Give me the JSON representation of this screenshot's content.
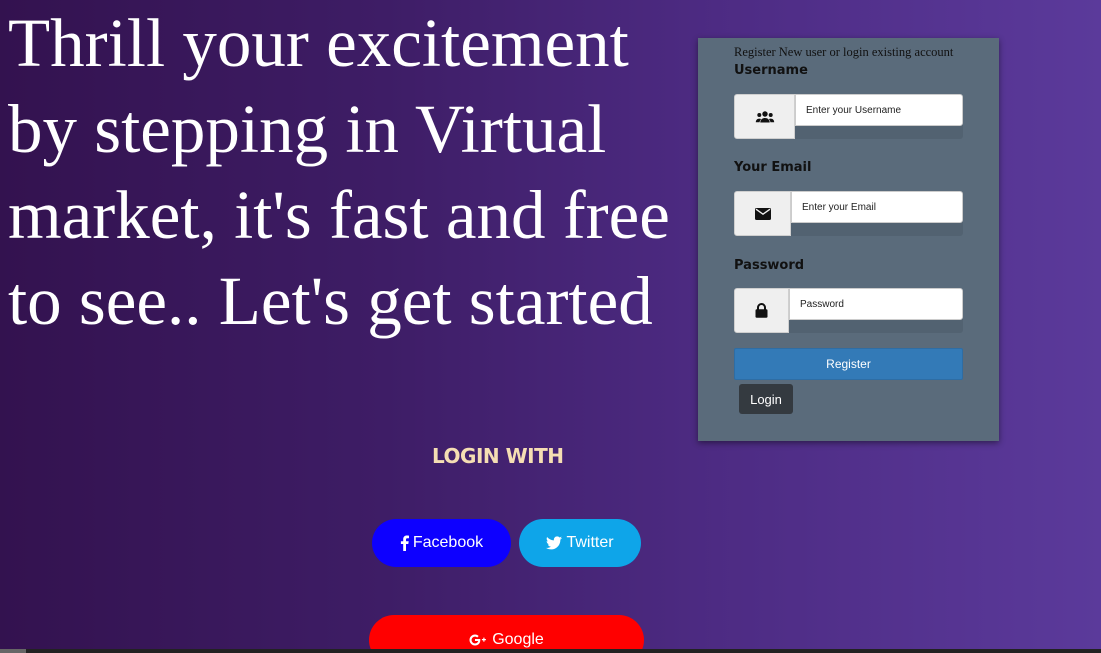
{
  "hero": {
    "headline": "Thrill your excitement by stepping in Virtual market, it's fast and free to see.. Let's get started"
  },
  "social": {
    "heading": "LOGIN WITH",
    "facebook_label": "Facebook",
    "twitter_label": "Twitter",
    "google_label": "Google",
    "facebook_icon": "facebook-f-icon",
    "twitter_icon": "twitter-bird-icon",
    "google_icon": "google-plus-icon",
    "colors": {
      "facebook": "#0d00ff",
      "twitter": "#0ea5e9",
      "google": "#ff0000"
    }
  },
  "form": {
    "header": "Register New user or login existing account",
    "username": {
      "label": "Username",
      "placeholder": "Enter your Username",
      "icon": "users-icon"
    },
    "email": {
      "label": "Your Email",
      "placeholder": "Enter your Email",
      "icon": "envelope-icon"
    },
    "password": {
      "label": "Password",
      "placeholder": "Password",
      "icon": "lock-icon"
    },
    "register_label": "Register",
    "login_label": "Login",
    "colors": {
      "panel": "#5a6b7b",
      "register": "#337ab7",
      "login": "#343a40"
    }
  }
}
